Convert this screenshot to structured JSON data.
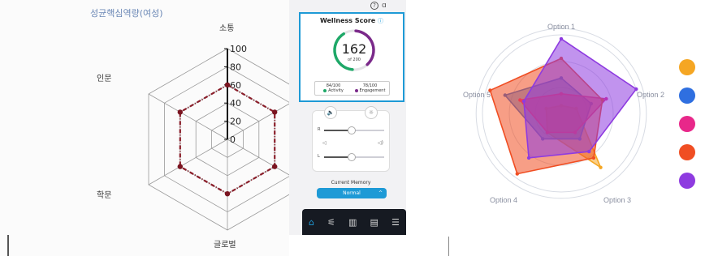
{
  "left_chart": {
    "title": "성균핵심역량(여성)",
    "axes": [
      "소통",
      "인문",
      "학문",
      "글로벌"
    ],
    "ticks": [
      "100",
      "80",
      "60",
      "40",
      "20",
      "0"
    ]
  },
  "app": {
    "wellness": {
      "title": "Wellness Score",
      "score": "162",
      "of_label": "of 200",
      "activity_value": "84/100",
      "activity_label": "Activity",
      "engagement_value": "78/100",
      "engagement_label": "Engagement",
      "activity_color": "#1ea868",
      "engagement_color": "#7b2a8a"
    },
    "audio": {
      "right_label": "R",
      "left_label": "L",
      "right_level": 0.45,
      "left_level": 0.45
    },
    "memory": {
      "label": "Current Memory",
      "value": "Normal"
    },
    "nav": [
      "home-icon",
      "sliders-icon",
      "chart-icon",
      "device-icon",
      "menu-icon"
    ]
  },
  "right_chart": {
    "options": [
      "Option 1",
      "Option 2",
      "Option 3",
      "Option 4",
      "Option 5"
    ],
    "legend_colors": [
      "#f5a623",
      "#2f6fe0",
      "#e8288a",
      "#f04e23",
      "#8e3be0"
    ]
  },
  "chart_data": [
    {
      "type": "radar",
      "title": "성균핵심역량(여성)",
      "categories": [
        "소통",
        "?",
        "?",
        "글로벌",
        "학문",
        "인문"
      ],
      "ylim": [
        0,
        100
      ],
      "series": [
        {
          "values": [
            60,
            60,
            60,
            60,
            60,
            60
          ]
        }
      ]
    },
    {
      "type": "radar",
      "categories": [
        "Option 1",
        "Option 2",
        "Option 3",
        "Option 4",
        "Option 5"
      ],
      "series": [
        {
          "color": "#f5a623",
          "values": [
            0.1,
            0.2,
            0.85,
            0.3,
            0.2
          ]
        },
        {
          "color": "#2f6fe0",
          "values": [
            0.45,
            0.4,
            0.4,
            0.4,
            0.75
          ]
        },
        {
          "color": "#e8288a",
          "values": [
            0.25,
            0.6,
            0.3,
            0.3,
            0.55
          ]
        },
        {
          "color": "#f04e23",
          "values": [
            0.7,
            0.55,
            0.7,
            0.95,
            0.95
          ]
        },
        {
          "color": "#8e3be0",
          "values": [
            0.95,
            1.0,
            0.6,
            0.7,
            0.5
          ]
        }
      ]
    }
  ]
}
